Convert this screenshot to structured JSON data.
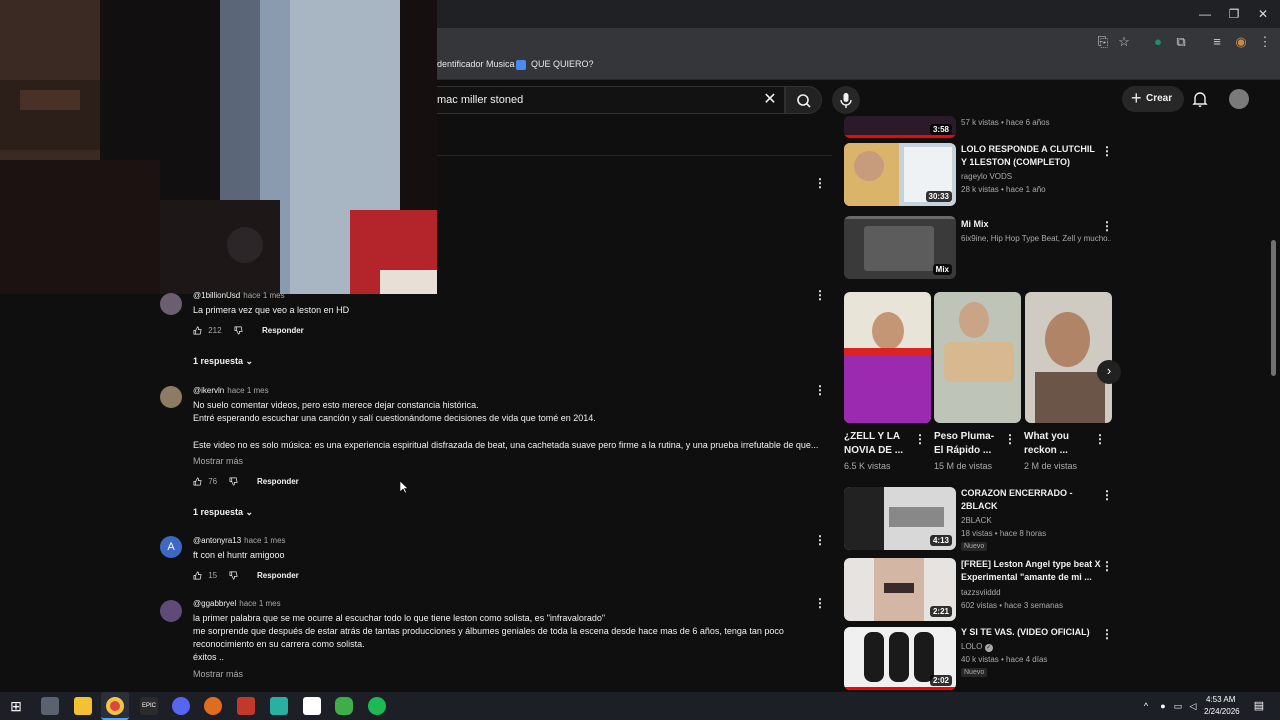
{
  "browser": {
    "bookmarks": [
      {
        "label": "dentificador Musica"
      },
      {
        "label": "QUE QUIERO?"
      }
    ]
  },
  "header": {
    "search_value": "mac miller stoned",
    "create_label": "Crear"
  },
  "comments": [
    {
      "user": "@1billionUsd",
      "time": "hace 1 mes",
      "lines": [
        "La primera vez que veo a leston en HD"
      ],
      "likes": "212",
      "reply_label": "Responder",
      "replies_label": "1 respuesta"
    },
    {
      "user": "@ikervln",
      "time": "hace 1 mes",
      "lines": [
        "No suelo comentar videos, pero esto merece dejar constancia histórica.",
        "Entré esperando escuchar una canción y salí cuestionándome decisiones de vida que tomé en 2014.",
        "",
        "Este video no es solo música: es una experiencia espiritual disfrazada de beat, una cachetada suave pero firme a la rutina, y una prueba irrefutable de que..."
      ],
      "more_label": "Mostrar más",
      "likes": "76",
      "reply_label": "Responder",
      "replies_label": "1 respuesta"
    },
    {
      "user": "@antonyra13",
      "time": "hace 1 mes",
      "avatar_letter": "A",
      "lines": [
        "ft con el huntr amigooo"
      ],
      "likes": "15",
      "reply_label": "Responder"
    },
    {
      "user": "@ggabbryel",
      "time": "hace 1 mes",
      "lines": [
        "la primer palabra que se me ocurre al escuchar todo lo que tiene leston como solista, es \"infravalorado\"",
        "me sorprende que después de estar atrás de tantas producciones y álbumes geniales de toda la escena desde hace mas de 6 años, tenga tan poco",
        "reconocimiento en su carrera como solista.",
        "éxitos .."
      ],
      "more_label": "Mostrar más"
    }
  ],
  "sidebar": {
    "top_partial": {
      "duration": "3:58",
      "meta": "57 k vistas • hace 6 años"
    },
    "videos": [
      {
        "title": "LOLO RESPONDE A CLUTCHIL Y 1LESTON (COMPLETO)",
        "channel": "rageylo VODS",
        "meta": "28 k vistas • hace 1 año",
        "duration": "30:33"
      },
      {
        "title": "Mi Mix",
        "channel": "6ix9ine, Hip Hop Type Beat, Zell y mucho...",
        "duration": "Mix"
      }
    ],
    "shorts": [
      {
        "title": "¿ZELL Y LA NOVIA DE ...",
        "views": "6.5 K vistas"
      },
      {
        "title": "Peso Pluma- El Rápido ...",
        "views": "15 M de vistas"
      },
      {
        "title": "What you reckon ...",
        "views": "2 M de vistas"
      }
    ],
    "videos2": [
      {
        "title": "CORAZON ENCERRADO - 2BLACK",
        "channel": "2BLACK",
        "meta": "18 vistas • hace 8 horas",
        "badge": "Nuevo",
        "duration": "4:13"
      },
      {
        "title": "[FREE] Leston Angel type beat X Experimental \"amante de mi ...",
        "channel": "tazzsviiddd",
        "meta": "602 vistas • hace 3 semanas",
        "duration": "2:21"
      },
      {
        "title": "Y SI TE VAS. (VIDEO OFICIAL)",
        "channel": "LOLO",
        "meta": "40 k vistas • hace 4 días",
        "badge": "Nuevo",
        "duration": "2:02"
      }
    ]
  },
  "taskbar": {
    "time": "4:53 AM",
    "date": "2/24/2026"
  }
}
